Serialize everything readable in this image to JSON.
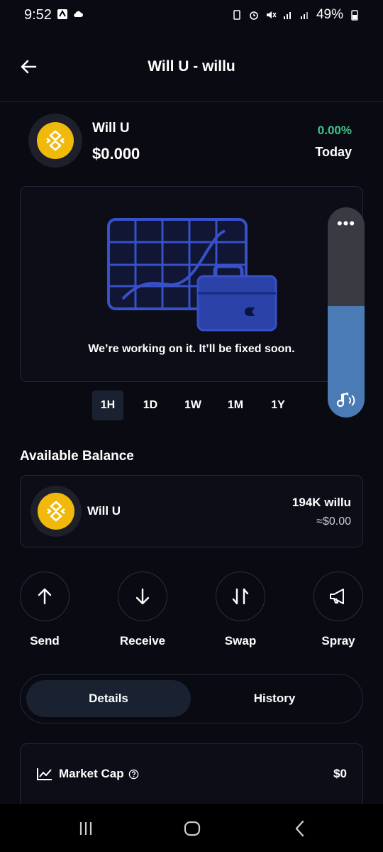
{
  "status_bar": {
    "time": "9:52",
    "battery": "49%"
  },
  "header": {
    "title": "Will U - willu"
  },
  "token": {
    "name": "Will U",
    "price": "$0.000",
    "change": "0.00%",
    "period": "Today"
  },
  "chart": {
    "message": "We’re working on it. It’ll be fixed soon."
  },
  "timeframes": [
    "1H",
    "1D",
    "1W",
    "1M",
    "1Y"
  ],
  "balance": {
    "title": "Available Balance",
    "name": "Will U",
    "amount": "194K willu",
    "fiat": "≈$0.00"
  },
  "actions": [
    "Send",
    "Receive",
    "Swap",
    "Spray"
  ],
  "tabs": {
    "details": "Details",
    "history": "History"
  },
  "details": {
    "market_cap_label": "Market Cap",
    "market_cap_value": "$0"
  },
  "volume_panel": {
    "level": 0.53,
    "menu": "•••"
  },
  "colors": {
    "accent_green": "#3ec48a",
    "bnb_yellow": "#f0b90b",
    "background": "#0a0a12",
    "volume_blue": "#4a7bb5"
  }
}
